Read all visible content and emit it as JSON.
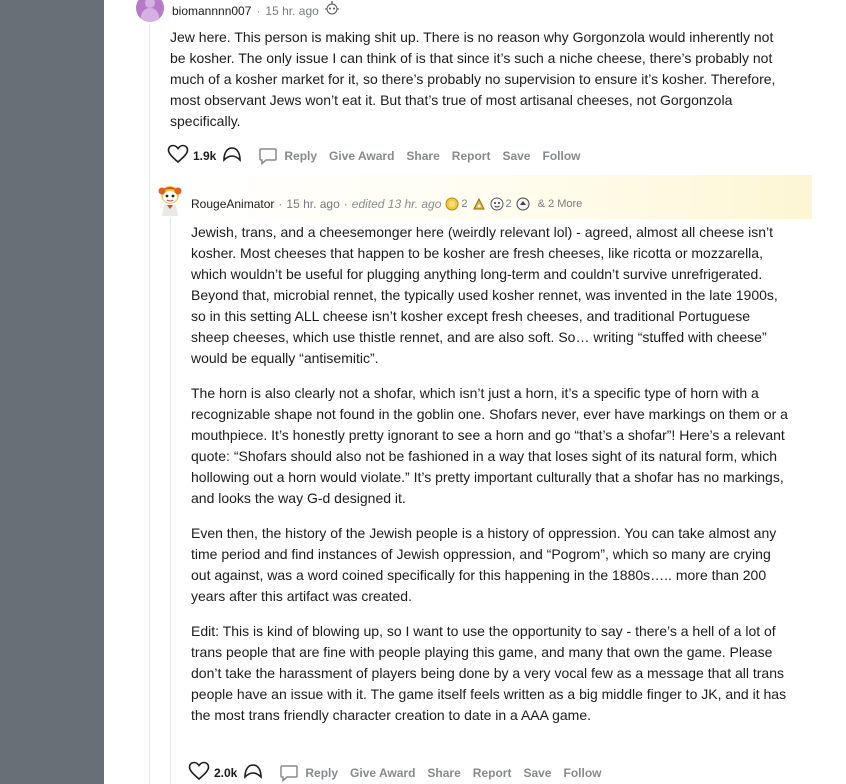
{
  "comment1": {
    "username": "biomannnn007",
    "timestamp": "15 hr. ago",
    "body": [
      "Jew here. This person is making shit up. There is no reason why Gorgonzola would inherently not be kosher. The only issue I can think of is that since it’s such a niche cheese, there’s probably not much of a kosher market for it, so there’s probably no supervision to ensure it’s kosher. Therefore, most observant Jews won’t eat it. But that’s true of most artisanal cheeses, not Gorgonzola specifically."
    ],
    "actions": {
      "upvotes": "1.9k",
      "reply": "Reply",
      "give_award": "Give Award",
      "share": "Share",
      "report": "Report",
      "save": "Save",
      "follow": "Follow"
    }
  },
  "comment2": {
    "username": "RougeAnimator",
    "timestamp": "15 hr. ago",
    "edited": "edited 13 hr. ago",
    "awards": [
      {
        "icon": "gold-award-icon",
        "count": "2"
      },
      {
        "icon": "helpful-award-icon",
        "count": ""
      },
      {
        "icon": "wholesome-award-icon",
        "count": "2"
      },
      {
        "icon": "silver-award-icon",
        "count": ""
      }
    ],
    "more_awards": "& 2 More",
    "body": [
      "Jewish, trans, and a cheesemonger here (weirdly relevant lol) - agreed, almost all cheese isn’t kosher. Most cheeses that happen to be kosher are fresh cheeses, like ricotta or mozzarella, which wouldn’t be useful for plugging anything long-term and couldn’t survive unrefrigerated. Beyond that, microbial rennet, the typically used kosher rennet, was invented in the late 1900s, so in this setting ALL cheese isn’t kosher except fresh cheeses, and traditional Portuguese sheep cheeses, which use thistle rennet, and are also soft. So… writing “stuffed with cheese” would be equally “antisemitic”.",
      "The horn is also clearly not a shofar, which isn’t just a horn, it’s a specific type of horn with a recognizable shape not found in the goblin one. Shofars never, ever have markings on them or a mouthpiece. It’s honestly pretty ignorant to see a horn and go “that’s a shofar”! Here’s a relevant quote: “Shofars should also not be fashioned in a way that loses sight of its natural form, which hollowing out a horn would violate.” It’s pretty important culturally that a shofar has no markings, and looks the way G-d designed it.",
      "Even then, the history of the Jewish people is a history of oppression. You can take almost any time period and find instances of Jewish oppression, and “Pogrom”, which so many are crying out against, was a word coined specifically for this happening in the 1880s….. more than 200 years after this artifact was created.",
      "Edit: This is kind of blowing up, so I want to use the opportunity to say - there’s a hell of a lot of trans people that are fine with people playing this game, and many that own the game. Please don’t take the harassment of players being done by a very vocal few as a message that all trans people have an issue with it. The game itself feels written as a big middle finger to JK, and it has the most trans friendly character creation to date in a AAA game."
    ],
    "actions": {
      "upvotes": "2.0k",
      "reply": "Reply",
      "give_award": "Give Award",
      "share": "Share",
      "report": "Report",
      "save": "Save",
      "follow": "Follow"
    }
  },
  "separator": "·",
  "colors": {
    "page_bg": "#686f77",
    "panel_bg": "#ffffff",
    "text": "#1c1c1c",
    "meta": "#787c7e",
    "award_highlight": "#fdf6d4"
  }
}
